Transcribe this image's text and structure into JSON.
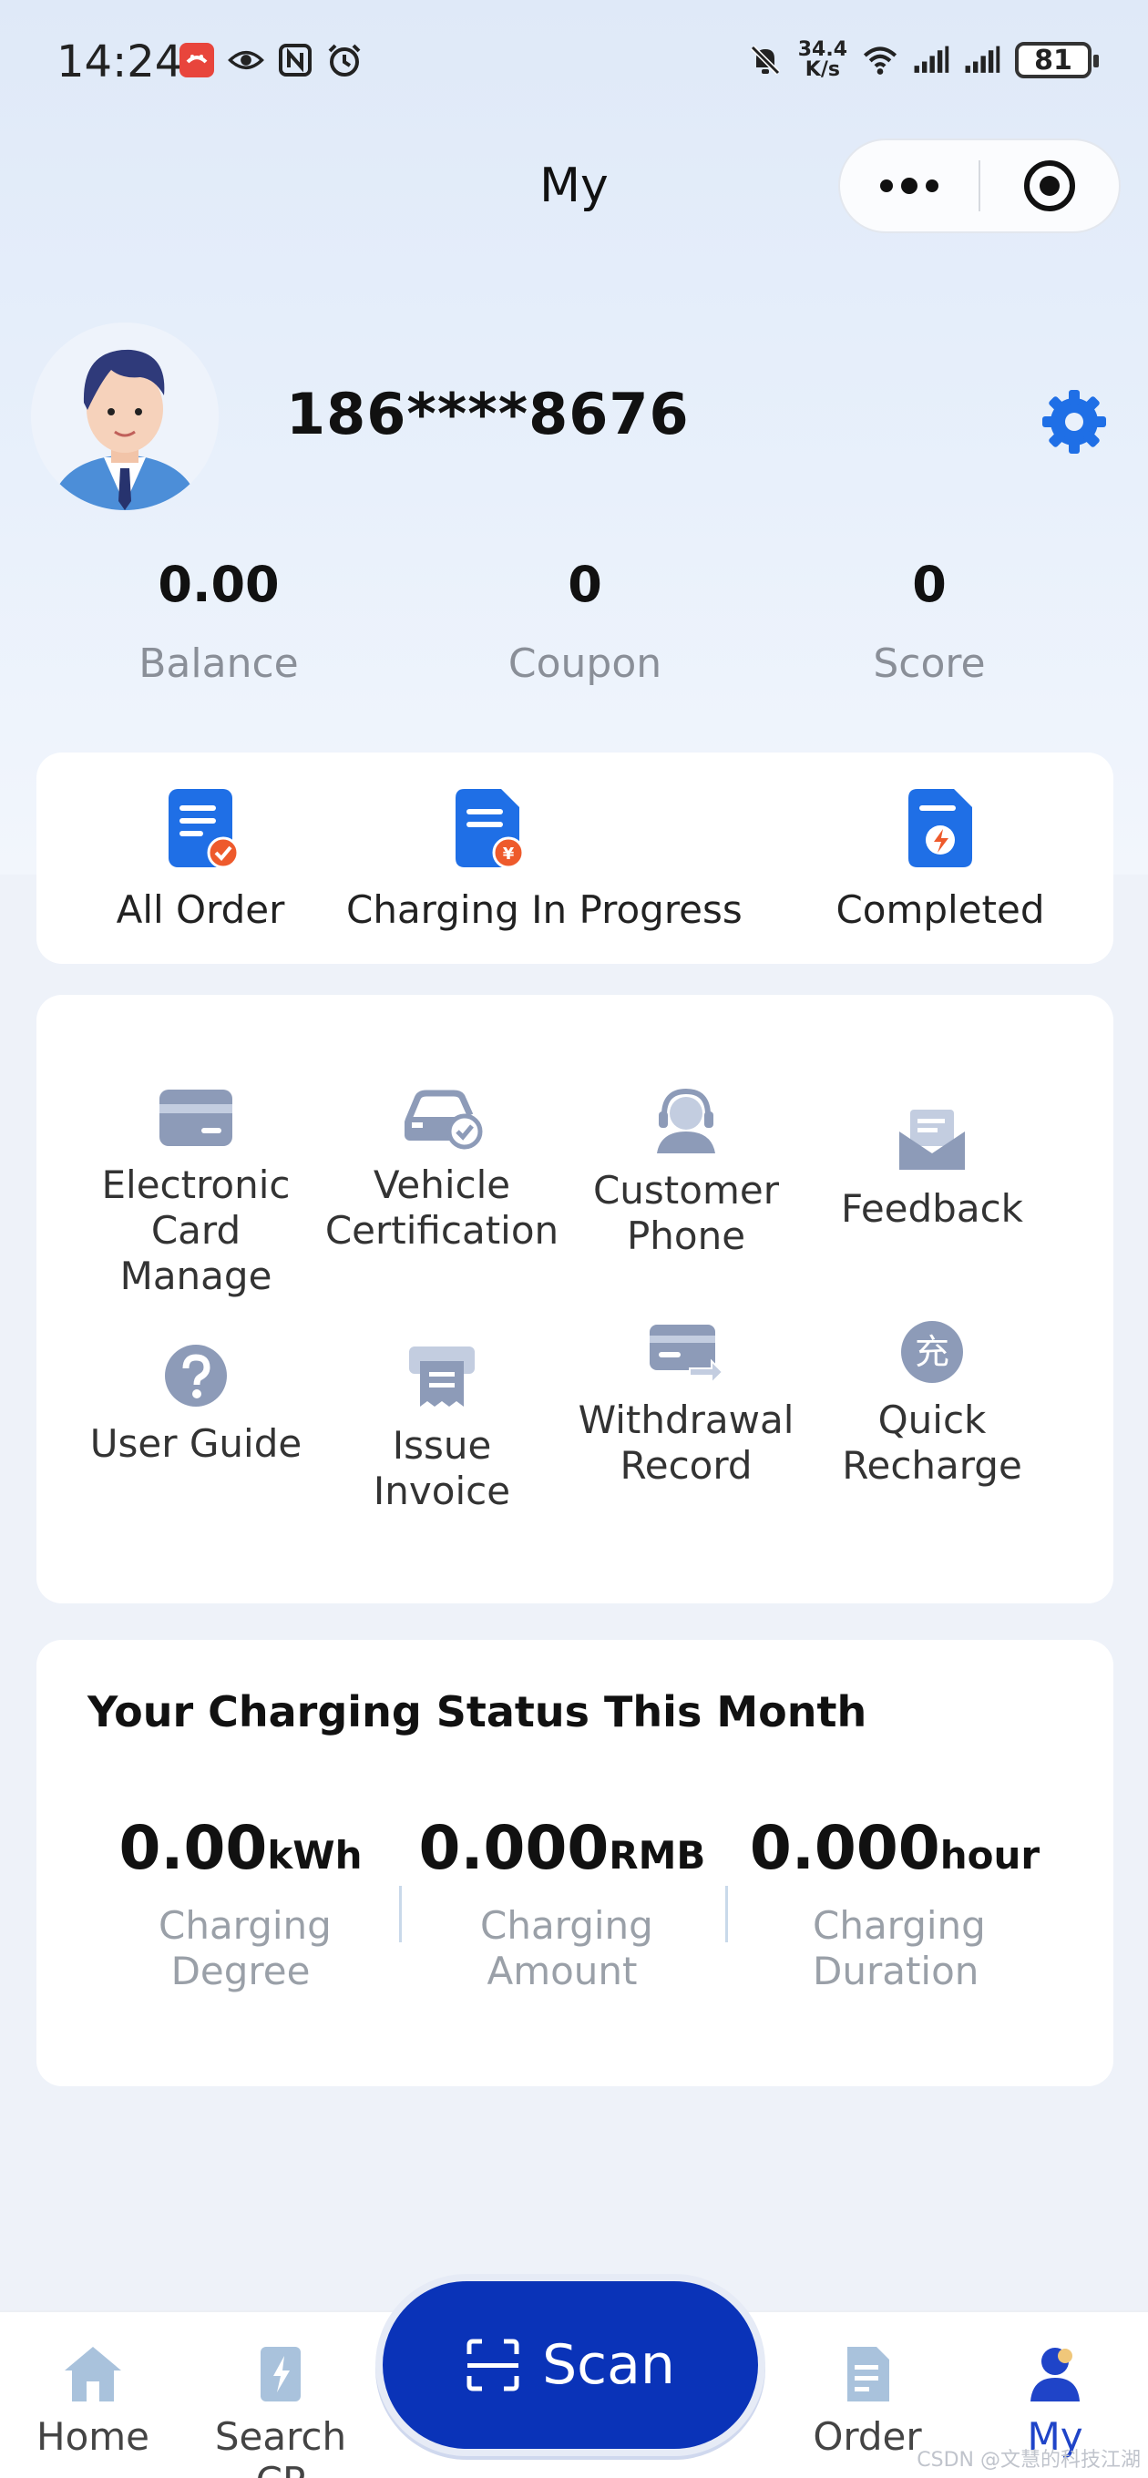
{
  "status_bar": {
    "time": "14:24",
    "net_speed_value": "34.4",
    "net_speed_unit": "K/s",
    "battery": "81"
  },
  "nav": {
    "title": "My"
  },
  "profile": {
    "phone": "186****8676"
  },
  "stats": [
    {
      "value": "0.00",
      "label": "Balance"
    },
    {
      "value": "0",
      "label": "Coupon"
    },
    {
      "value": "0",
      "label": "Score"
    }
  ],
  "orders": [
    {
      "label": "All Order",
      "icon": "all-order-icon"
    },
    {
      "label": "Charging In Progress",
      "icon": "charging-order-icon"
    },
    {
      "label": "Completed",
      "icon": "completed-order-icon"
    }
  ],
  "tools": [
    {
      "label": "Electronic Card Manage",
      "icon": "card-icon"
    },
    {
      "label": "Vehicle Certification",
      "icon": "vehicle-icon"
    },
    {
      "label": "Customer Phone",
      "icon": "headset-icon"
    },
    {
      "label": "Feedback",
      "icon": "envelope-icon"
    },
    {
      "label": "User Guide",
      "icon": "question-icon"
    },
    {
      "label": "Issue Invoice",
      "icon": "printer-icon"
    },
    {
      "label": "Withdrawal Record",
      "icon": "withdraw-card-icon"
    },
    {
      "label": "Quick Recharge",
      "icon": "recharge-icon",
      "glyph": "充"
    }
  ],
  "charging_status": {
    "title": "Your Charging Status This Month",
    "metrics": [
      {
        "value": "0.00",
        "unit": "kWh",
        "label": "Charging Degree"
      },
      {
        "value": "0.000",
        "unit": "RMB",
        "label": "Charging Amount"
      },
      {
        "value": "0.000",
        "unit": "hour",
        "label": "Charging Duration"
      }
    ]
  },
  "tabbar": {
    "home": "Home",
    "search": "Search CP",
    "scan": "Scan",
    "order": "Order",
    "my": "My"
  },
  "watermark": "CSDN @文慧的科技江湖",
  "colors": {
    "accent": "#1f6fe6",
    "scan": "#0a33b8",
    "muted_icon": "#8d9bb8"
  }
}
